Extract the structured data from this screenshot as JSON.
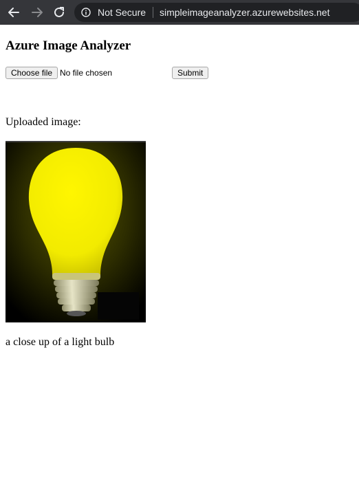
{
  "browser": {
    "security_label": "Not Secure",
    "url": "simpleimageanalyzer.azurewebsites.net",
    "icons": [
      "back-arrow-icon",
      "forward-arrow-icon",
      "reload-icon",
      "info-icon"
    ]
  },
  "page": {
    "title": "Azure Image Analyzer",
    "file_input": {
      "button_label": "Choose file",
      "status": "No file chosen"
    },
    "submit_label": "Submit",
    "uploaded_label": "Uploaded image:",
    "caption": "a close up of a light bulb"
  }
}
